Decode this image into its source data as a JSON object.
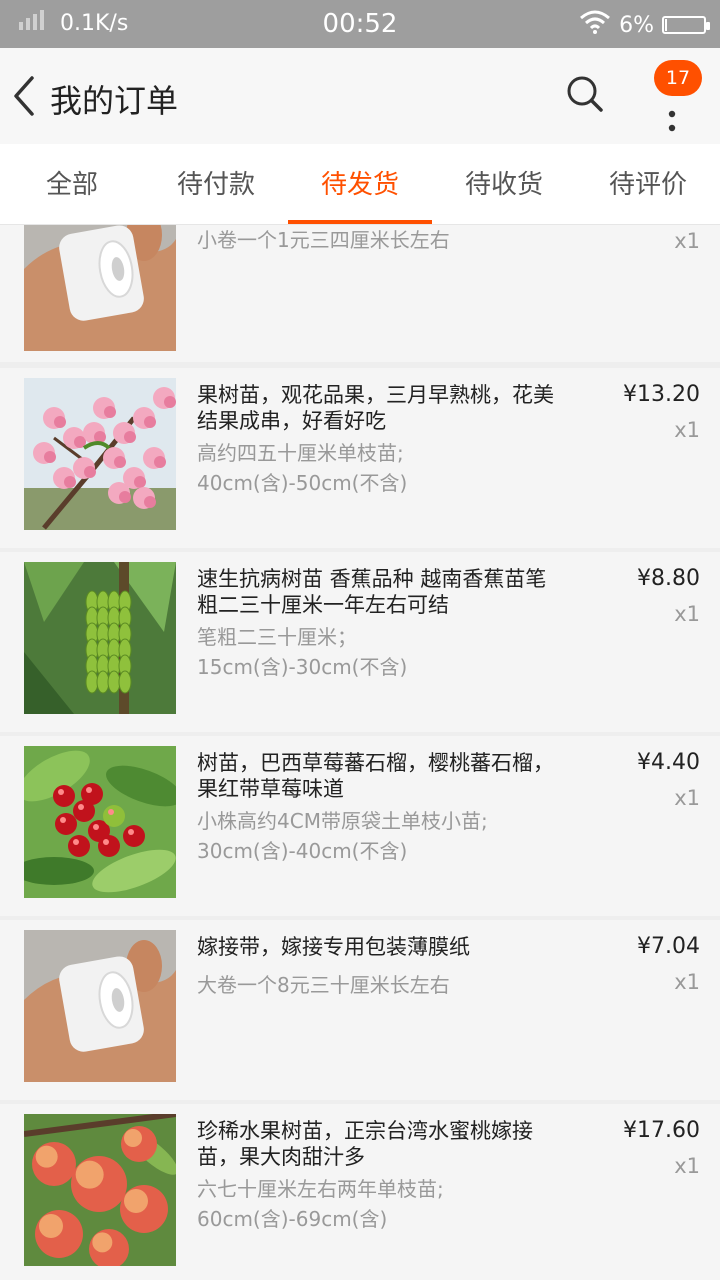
{
  "status_bar": {
    "speed": "0.1K/s",
    "time": "00:52",
    "battery": "6%",
    "battery_level": 0.06
  },
  "nav": {
    "title": "我的订单",
    "badge": "17"
  },
  "tabs": [
    {
      "label": "全部"
    },
    {
      "label": "待付款"
    },
    {
      "label": "待发货",
      "active": true
    },
    {
      "label": "待收货"
    },
    {
      "label": "待评价"
    }
  ],
  "items": [
    {
      "name": "",
      "spec": "小卷一个1元三四厘米长左右",
      "price": "",
      "qty": "x1",
      "image": "film-roll"
    },
    {
      "name": "果树苗，观花品果，三月早熟桃，花美结果成串，好看好吃",
      "spec": "高约四五十厘米单枝苗;\n40cm(含)-50cm(不含)",
      "price": "¥13.20",
      "qty": "x1",
      "image": "peach-blossom"
    },
    {
      "name": "速生抗病树苗 香蕉品种  越南香蕉苗笔粗二三十厘米一年左右可结",
      "spec": " 笔粗二三十厘米；\n15cm(含)-30cm(不含)",
      "price": "¥8.80",
      "qty": "x1",
      "image": "banana"
    },
    {
      "name": "树苗，巴西草莓蕃石榴，樱桃蕃石榴，果红带草莓味道",
      "spec": " 小株高约4CM带原袋土单枝小苗;\n30cm(含)-40cm(不含)",
      "price": "¥4.40",
      "qty": "x1",
      "image": "cherry"
    },
    {
      "name": "嫁接带，嫁接专用包装薄膜纸",
      "spec": "大卷一个8元三十厘米长左右",
      "price": "¥7.04",
      "qty": "x1",
      "image": "film-roll"
    },
    {
      "name": "珍稀水果树苗，正宗台湾水蜜桃嫁接苗，果大肉甜汁多",
      "spec": "六七十厘米左右两年单枝苗;\n60cm(含)-69cm(含)",
      "price": "¥17.60",
      "qty": "x1",
      "image": "peaches"
    }
  ]
}
